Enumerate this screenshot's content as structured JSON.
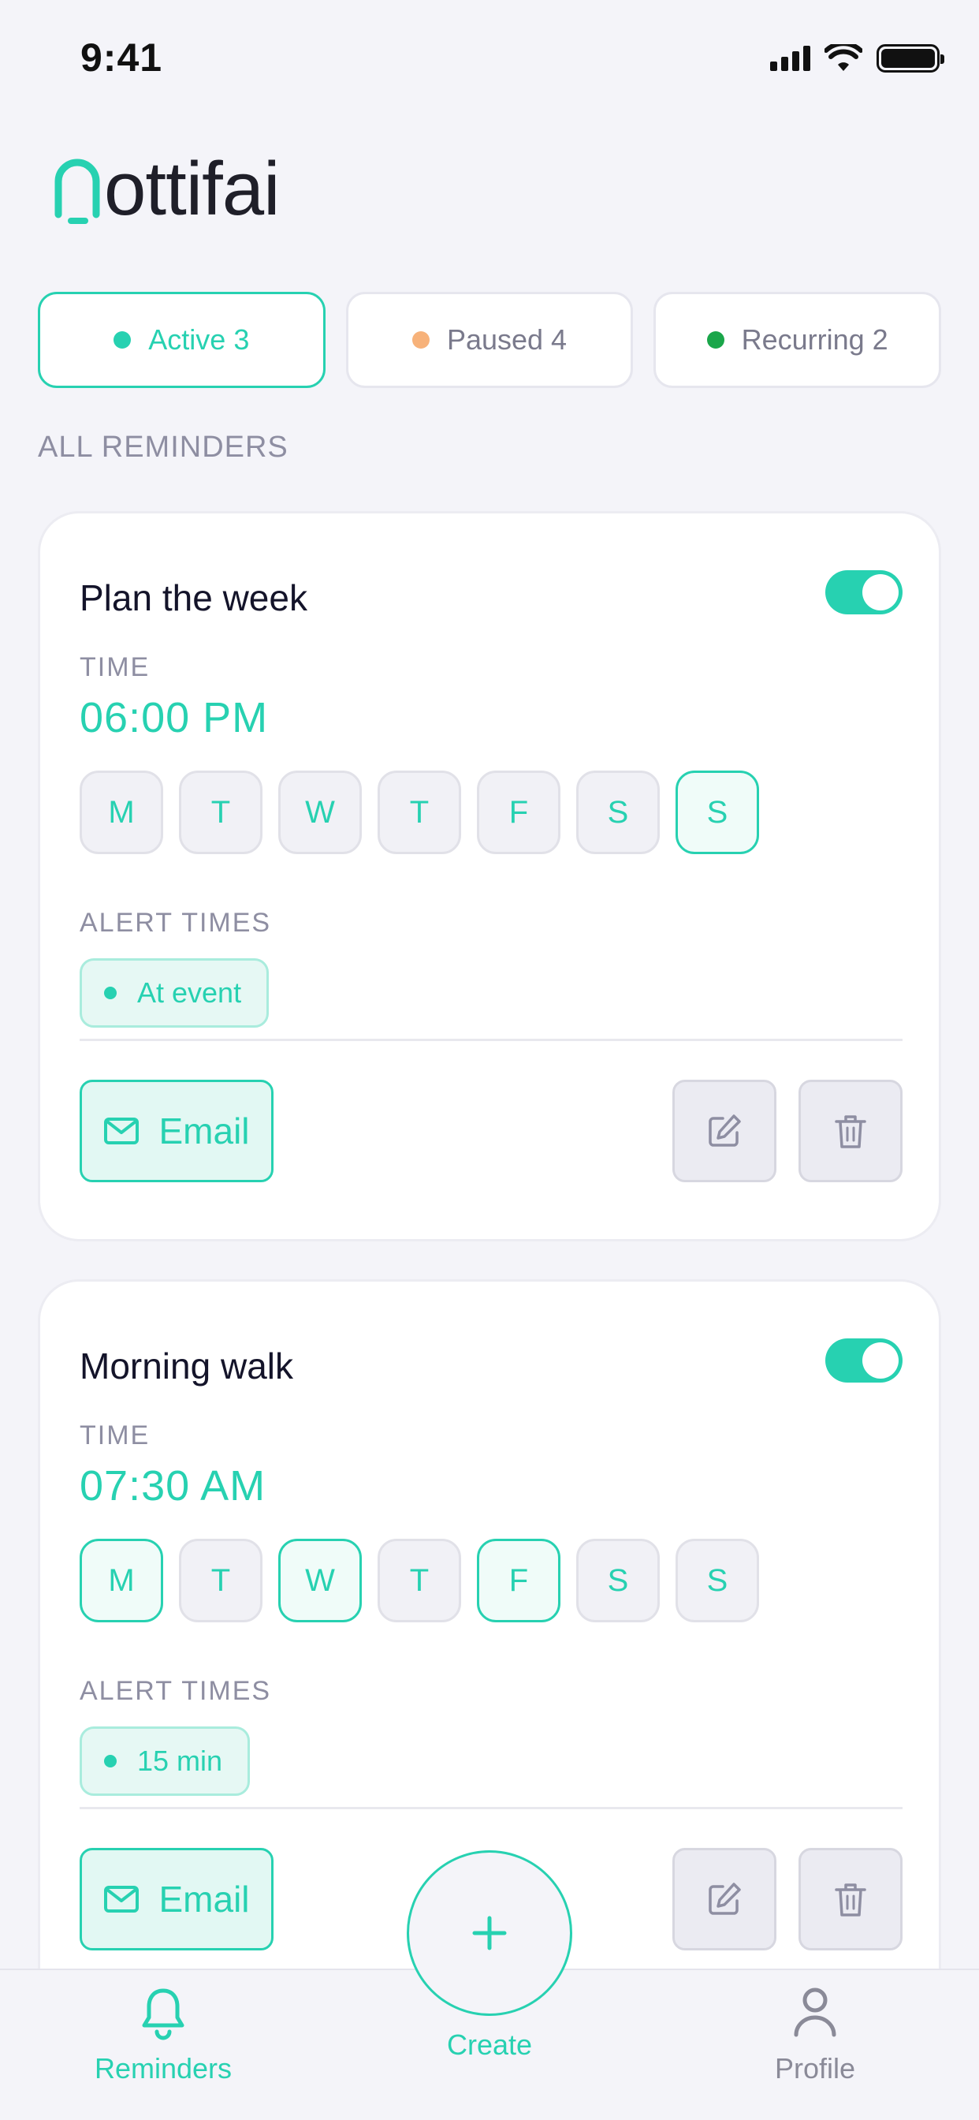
{
  "status_bar": {
    "time": "9:41"
  },
  "app": {
    "logo_text": "ottifai",
    "brand_color": "#27d1b1"
  },
  "filters": [
    {
      "label": "Active 3",
      "dot_color": "#27d1b1",
      "selected": true
    },
    {
      "label": "Paused 4",
      "dot_color": "#f7b27a",
      "selected": false
    },
    {
      "label": "Recurring 2",
      "dot_color": "#1aa64a",
      "selected": false
    }
  ],
  "section_title": "ALL REMINDERS",
  "reminders": [
    {
      "title": "Plan the week",
      "enabled": true,
      "time_label": "TIME",
      "time": "06:00 PM",
      "days": [
        {
          "label": "M",
          "on": false
        },
        {
          "label": "T",
          "on": false
        },
        {
          "label": "W",
          "on": false
        },
        {
          "label": "T",
          "on": false
        },
        {
          "label": "F",
          "on": false
        },
        {
          "label": "S",
          "on": false
        },
        {
          "label": "S",
          "on": true
        }
      ],
      "alert_label": "ALERT TIMES",
      "alert": "At event",
      "channel": "Email"
    },
    {
      "title": "Morning walk",
      "enabled": true,
      "time_label": "TIME",
      "time": "07:30 AM",
      "days": [
        {
          "label": "M",
          "on": true
        },
        {
          "label": "T",
          "on": false
        },
        {
          "label": "W",
          "on": true
        },
        {
          "label": "T",
          "on": false
        },
        {
          "label": "F",
          "on": true
        },
        {
          "label": "S",
          "on": false
        },
        {
          "label": "S",
          "on": false
        }
      ],
      "alert_label": "ALERT TIMES",
      "alert": "15 min",
      "channel": "Email"
    }
  ],
  "tabbar": {
    "reminders": "Reminders",
    "create": "Create",
    "profile": "Profile"
  },
  "icons": {
    "signal": "cellular-signal-icon",
    "wifi": "wifi-icon",
    "battery": "battery-icon",
    "email": "mail-icon",
    "edit": "edit-icon",
    "delete": "trash-icon",
    "bell": "bell-icon",
    "plus": "plus-icon",
    "profile": "user-icon"
  }
}
